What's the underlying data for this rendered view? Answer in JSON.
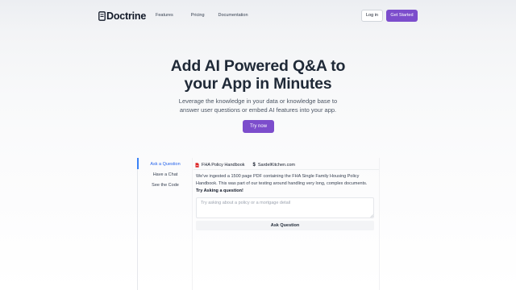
{
  "nav": {
    "logo_text": "Doctrine",
    "links": [
      "Features",
      "Pricing",
      "Documentation"
    ],
    "login_label": "Log in",
    "get_started_label": "Get Started"
  },
  "hero": {
    "title_line1": "Add AI Powered Q&A to",
    "title_line2": "your App in Minutes",
    "subtitle_line1": "Leverage the knowledge in your data or knowledge base to",
    "subtitle_line2": "answer user questions or embed AI features into your app.",
    "cta_label": "Try now"
  },
  "demo": {
    "sidebar": [
      {
        "label": "Ask a Question",
        "active": true
      },
      {
        "label": "Have a Chat",
        "active": false
      },
      {
        "label": "See the Code",
        "active": false
      }
    ],
    "tabs": [
      {
        "label": "FHA Policy Handbook",
        "icon": "pdf-icon"
      },
      {
        "label": "SardelKitchen.com",
        "icon": "dollar-icon"
      }
    ],
    "description_line1": "We've ingested a 1500 page PDF containing the FHA Single Family Housing Policy",
    "description_line2": "Handbook. This was part of our testing around handling very long, complex documents.",
    "prompt_label": "Try Asking a question!",
    "input_placeholder": "Try asking about a policy or a mortgage detail",
    "input_value": "",
    "ask_button_label": "Ask Question"
  },
  "colors": {
    "brand": "#7c4dcc",
    "active_link": "#2563eb",
    "active_bar": "#3b82f6",
    "pdf_icon": "#dc2626"
  }
}
